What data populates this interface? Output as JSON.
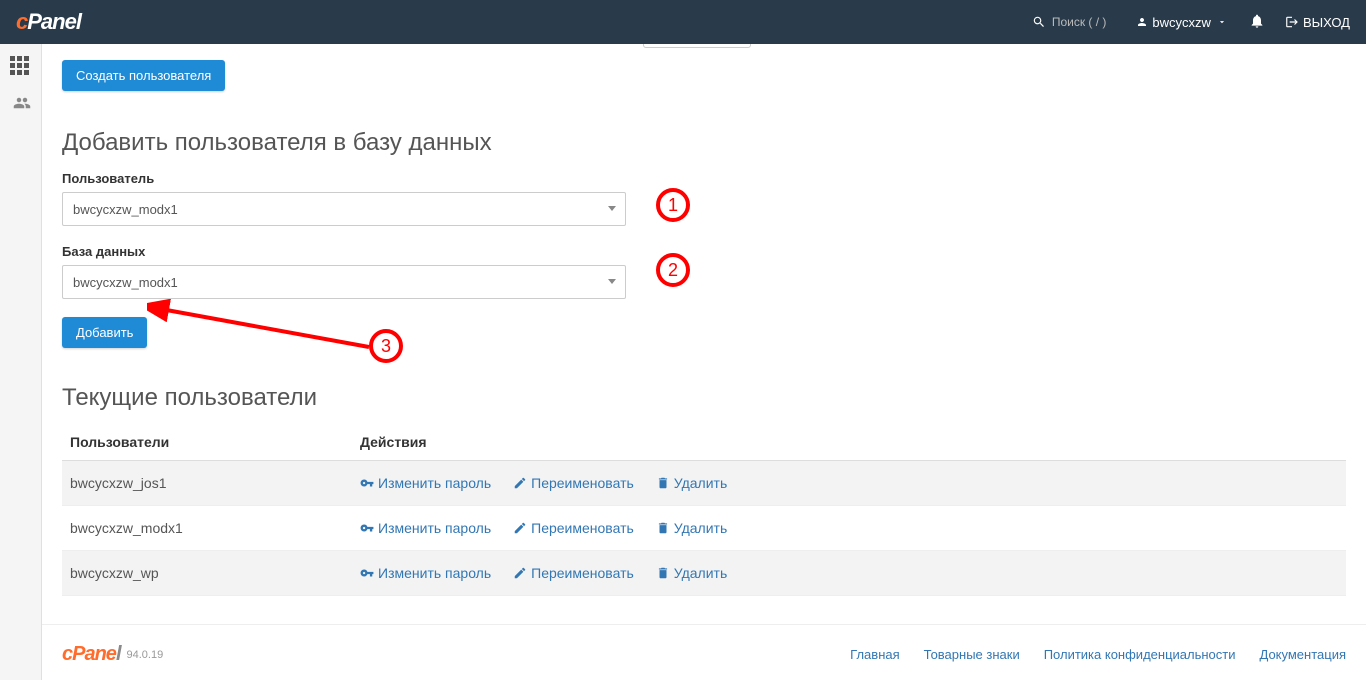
{
  "header": {
    "logo_c": "c",
    "logo_panel": "Panel",
    "search_placeholder": "Поиск ( / )",
    "username": "bwcycxzw",
    "logout": "ВЫХОД"
  },
  "buttons": {
    "create_user": "Создать пользователя",
    "add": "Добавить"
  },
  "sections": {
    "add_user": "Добавить пользователя в базу данных",
    "current_users": "Текущие пользователи"
  },
  "labels": {
    "user": "Пользователь",
    "database": "База данных"
  },
  "selects": {
    "user_value": "bwcycxzw_modx1",
    "db_value": "bwcycxzw_modx1"
  },
  "annotations": {
    "n1": "1",
    "n2": "2",
    "n3": "3"
  },
  "table": {
    "col_users": "Пользователи",
    "col_actions": "Действия",
    "rows": [
      {
        "name": "bwcycxzw_jos1"
      },
      {
        "name": "bwcycxzw_modx1"
      },
      {
        "name": "bwcycxzw_wp"
      }
    ],
    "actions": {
      "change_pw": "Изменить пароль",
      "rename": "Переименовать",
      "delete": "Удалить"
    }
  },
  "footer": {
    "logo_c": "cPane",
    "logo_l": "l",
    "version": "94.0.19",
    "links": {
      "home": "Главная",
      "trademarks": "Товарные знаки",
      "privacy": "Политика конфиденциальности",
      "docs": "Документация"
    }
  }
}
